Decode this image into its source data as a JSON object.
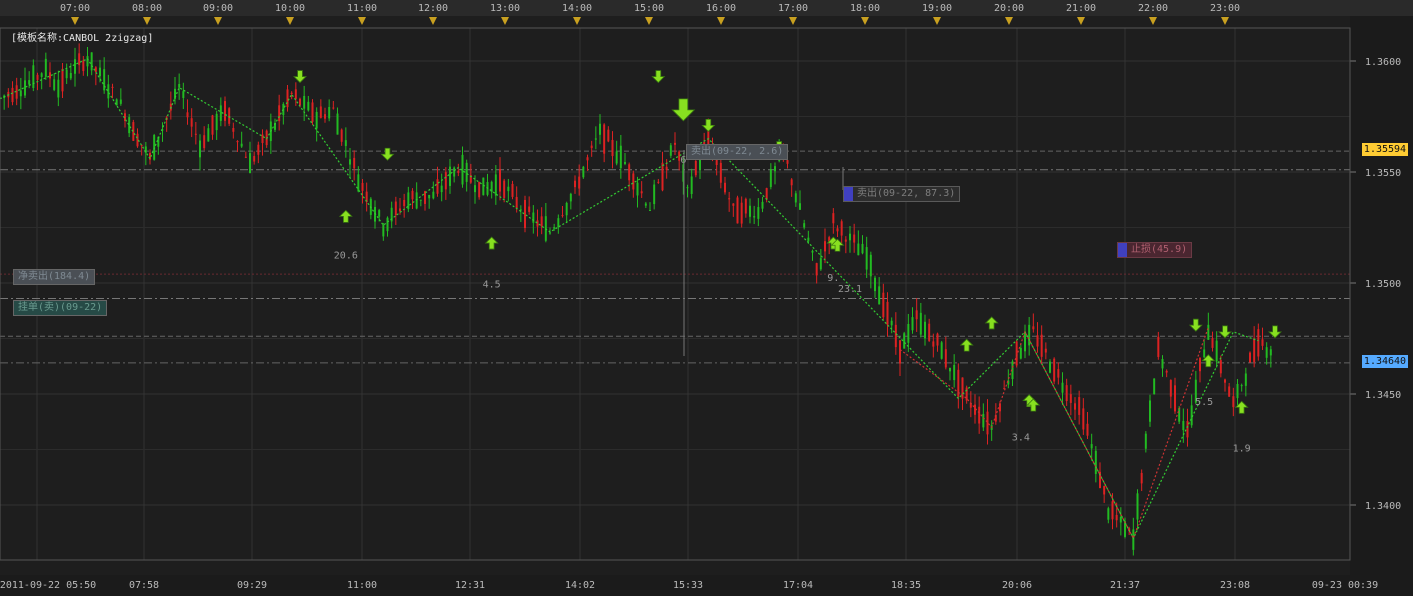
{
  "chart_data": {
    "type": "candlestick",
    "title": "[模板名称:CANBOL 2zigzag]",
    "top_time_ticks": [
      "07:00",
      "08:00",
      "09:00",
      "10:00",
      "11:00",
      "12:00",
      "13:00",
      "14:00",
      "15:00",
      "16:00",
      "17:00",
      "18:00",
      "19:00",
      "20:00",
      "21:00",
      "22:00",
      "23:00"
    ],
    "bottom_time_ticks": [
      "2011-09-22 05:50",
      "07:58",
      "09:29",
      "11:00",
      "12:31",
      "14:02",
      "15:33",
      "17:04",
      "18:35",
      "20:06",
      "21:37",
      "23:08",
      "09-23 00:39"
    ],
    "y_ticks": [
      "1.3600",
      "1.3550",
      "1.3500",
      "1.3450",
      "1.3400"
    ],
    "ylim": [
      1.3375,
      1.3625
    ],
    "current_price": "1.35594",
    "last_price": "1.34640",
    "colors": {
      "up": "#22bb22",
      "down": "#dd2222",
      "arrow": "#88e020",
      "current_price_bg": "#ffcc33",
      "last_price_bg": "#55aaff"
    },
    "price_path": [
      [
        0,
        1.3583
      ],
      [
        6,
        1.3589
      ],
      [
        11,
        1.3596
      ],
      [
        14,
        1.3589
      ],
      [
        18,
        1.3597
      ],
      [
        21,
        1.3601
      ],
      [
        28,
        1.3584
      ],
      [
        32,
        1.3569
      ],
      [
        36,
        1.3556
      ],
      [
        43,
        1.3588
      ],
      [
        48,
        1.3562
      ],
      [
        54,
        1.3578
      ],
      [
        60,
        1.3554
      ],
      [
        64,
        1.3565
      ],
      [
        70,
        1.3585
      ],
      [
        76,
        1.3575
      ],
      [
        80,
        1.3578
      ],
      [
        86,
        1.3547
      ],
      [
        92,
        1.3526
      ],
      [
        98,
        1.3538
      ],
      [
        104,
        1.3539
      ],
      [
        110,
        1.3552
      ],
      [
        116,
        1.3542
      ],
      [
        120,
        1.3546
      ],
      [
        126,
        1.3532
      ],
      [
        132,
        1.3523
      ],
      [
        138,
        1.3542
      ],
      [
        144,
        1.3568
      ],
      [
        150,
        1.3554
      ],
      [
        156,
        1.3534
      ],
      [
        162,
        1.3563
      ],
      [
        165,
        1.3541
      ],
      [
        170,
        1.3565
      ],
      [
        176,
        1.3533
      ],
      [
        182,
        1.3532
      ],
      [
        188,
        1.356
      ],
      [
        193,
        1.3526
      ],
      [
        196,
        1.3505
      ],
      [
        200,
        1.3527
      ],
      [
        208,
        1.3512
      ],
      [
        216,
        1.347
      ],
      [
        220,
        1.3484
      ],
      [
        226,
        1.347
      ],
      [
        232,
        1.3448
      ],
      [
        238,
        1.3435
      ],
      [
        244,
        1.3468
      ],
      [
        248,
        1.3478
      ],
      [
        254,
        1.3458
      ],
      [
        260,
        1.344
      ],
      [
        266,
        1.3398
      ],
      [
        272,
        1.3385
      ],
      [
        278,
        1.347
      ],
      [
        285,
        1.3432
      ],
      [
        290,
        1.348
      ],
      [
        296,
        1.3445
      ],
      [
        302,
        1.3474
      ],
      [
        306,
        1.3469
      ]
    ],
    "zigzag_green": [
      [
        0,
        1.3583
      ],
      [
        21,
        1.3601
      ],
      [
        36,
        1.3556
      ],
      [
        43,
        1.3588
      ],
      [
        64,
        1.3565
      ],
      [
        70,
        1.3585
      ],
      [
        92,
        1.3526
      ],
      [
        110,
        1.3552
      ],
      [
        132,
        1.3523
      ],
      [
        170,
        1.3565
      ],
      [
        230,
        1.3448
      ],
      [
        246,
        1.3478
      ],
      [
        272,
        1.3385
      ],
      [
        296,
        1.3478
      ],
      [
        302,
        1.3474
      ]
    ],
    "zigzag_red": [
      [
        216,
        1.347
      ],
      [
        232,
        1.3448
      ],
      [
        238,
        1.3435
      ],
      [
        246,
        1.3478
      ],
      [
        272,
        1.3385
      ],
      [
        290,
        1.348
      ]
    ],
    "down_arrows": [
      [
        72,
        1.3593
      ],
      [
        93,
        1.3558
      ],
      [
        158,
        1.3593
      ],
      [
        170,
        1.3571
      ],
      [
        187,
        1.3561
      ],
      [
        287,
        1.3481
      ],
      [
        294,
        1.3478
      ],
      [
        306,
        1.3478
      ]
    ],
    "up_arrows": [
      [
        83,
        1.353
      ],
      [
        118,
        1.3518
      ],
      [
        200,
        1.3518
      ],
      [
        201,
        1.3517
      ],
      [
        232,
        1.3472
      ],
      [
        238,
        1.3482
      ],
      [
        247,
        1.3447
      ],
      [
        248,
        1.3445
      ],
      [
        290,
        1.3465
      ],
      [
        298,
        1.3444
      ]
    ],
    "big_down_arrow": [
      164,
      1.3578
    ],
    "arrow_labels": [
      {
        "text": "20.6",
        "x": 83,
        "y": 1.3511
      },
      {
        "text": "4.5",
        "x": 118,
        "y": 1.3498
      },
      {
        "text": "9.",
        "x": 200,
        "y": 1.3501
      },
      {
        "text": "23.1",
        "x": 204,
        "y": 1.3496
      },
      {
        "text": "3.4",
        "x": 245,
        "y": 1.3429
      },
      {
        "text": "5.5",
        "x": 289,
        "y": 1.3445
      },
      {
        "text": "1.9",
        "x": 298,
        "y": 1.3424
      },
      {
        "text": "6",
        "x": 164,
        "y": 1.3554
      }
    ],
    "horizontal_levels": [
      {
        "price": 1.35594,
        "style": "dash",
        "color": "#666"
      },
      {
        "price": 1.3551,
        "style": "dashdot",
        "color": "#777"
      },
      {
        "price": 1.3504,
        "style": "dot",
        "color": "#6a2a30"
      },
      {
        "price": 1.3493,
        "style": "dashdot",
        "color": "#777"
      },
      {
        "price": 1.3476,
        "style": "dash",
        "color": "#666"
      },
      {
        "price": 1.3464,
        "style": "dashdot",
        "color": "#666"
      }
    ],
    "grid": true
  },
  "annotations": {
    "net_sell": "净卖出(184.4)",
    "pending_sell": "挂单(卖)(09-22)",
    "sell1": "卖出(09-22, 2.6)",
    "sell2": "卖出(09-22, 87.3)",
    "stop_loss": "止损(45.9)"
  }
}
